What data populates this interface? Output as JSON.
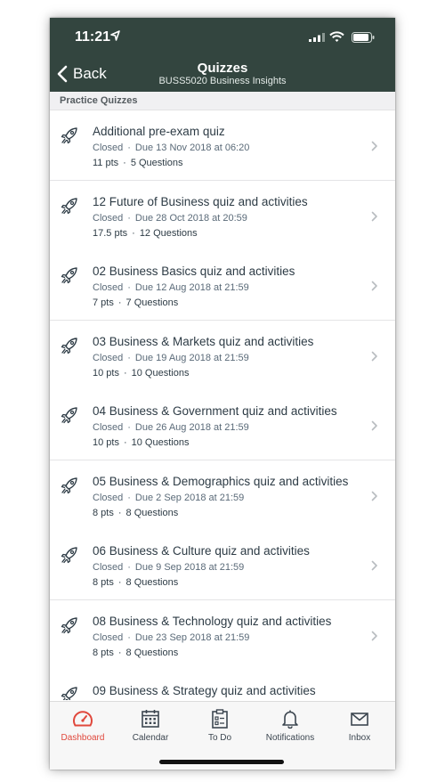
{
  "status_bar": {
    "time": "11:21"
  },
  "nav": {
    "back_label": "Back",
    "title": "Quizzes",
    "subtitle": "BUSS5020 Business Insights"
  },
  "section": {
    "label": "Practice Quizzes"
  },
  "quizzes": [
    {
      "title": "Additional pre-exam quiz",
      "status": "Closed",
      "due": "Due 13 Nov 2018 at 06:20",
      "points": "11 pts",
      "questions": "5 Questions"
    },
    {
      "title": " 12 Future of Business quiz and activities",
      "status": "Closed",
      "due": "Due 28 Oct 2018 at 20:59",
      "points": "17.5 pts",
      "questions": "12 Questions"
    },
    {
      "title": "02 Business Basics  quiz and activities",
      "status": "Closed",
      "due": "Due 12 Aug 2018 at 21:59",
      "points": "7 pts",
      "questions": "7 Questions"
    },
    {
      "title": "03 Business & Markets quiz and activities",
      "status": "Closed",
      "due": "Due 19 Aug 2018 at 21:59",
      "points": "10 pts",
      "questions": "10 Questions"
    },
    {
      "title": "04 Business & Government quiz and activities",
      "status": "Closed",
      "due": "Due 26 Aug 2018 at 21:59",
      "points": "10 pts",
      "questions": "10 Questions"
    },
    {
      "title": "05 Business & Demographics quiz and activities",
      "status": "Closed",
      "due": "Due 2 Sep 2018 at 21:59",
      "points": "8 pts",
      "questions": "8 Questions"
    },
    {
      "title": "06 Business & Culture quiz and activities",
      "status": "Closed",
      "due": "Due 9 Sep 2018 at 21:59",
      "points": "8 pts",
      "questions": "8 Questions"
    },
    {
      "title": "08 Business & Technology quiz and activities",
      "status": "Closed",
      "due": "Due 23 Sep 2018 at 21:59",
      "points": "8 pts",
      "questions": "8 Questions"
    },
    {
      "title": "09 Business & Strategy quiz and activities",
      "status": "",
      "due": "",
      "points": "",
      "questions": ""
    }
  ],
  "tabs": [
    {
      "label": "Dashboard",
      "icon": "dashboard-icon",
      "active": true
    },
    {
      "label": "Calendar",
      "icon": "calendar-icon",
      "active": false
    },
    {
      "label": "To Do",
      "icon": "todo-icon",
      "active": false
    },
    {
      "label": "Notifications",
      "icon": "bell-icon",
      "active": false
    },
    {
      "label": "Inbox",
      "icon": "inbox-icon",
      "active": false
    }
  ],
  "colors": {
    "nav_background": "#33453f",
    "active_tab": "#e0483c",
    "secondary_text": "#5a6a78",
    "primary_text": "#2d3b45"
  }
}
